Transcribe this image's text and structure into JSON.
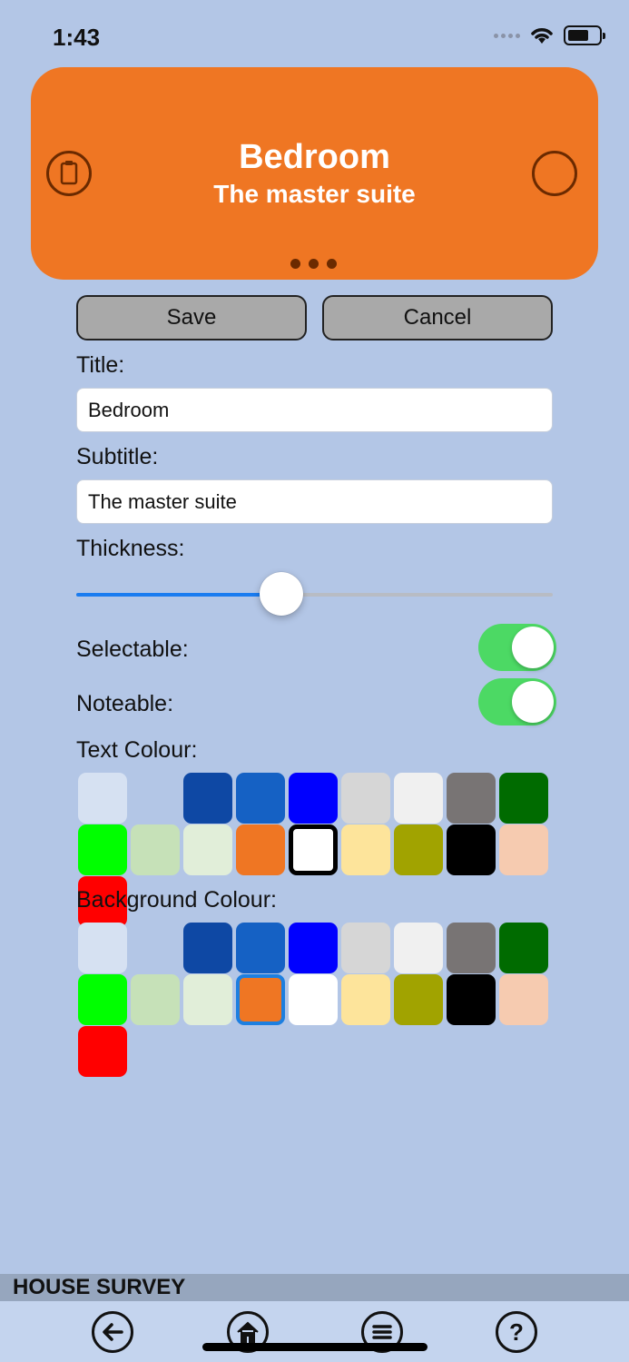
{
  "status_bar": {
    "time": "1:43"
  },
  "card": {
    "title": "Bedroom",
    "subtitle": "The master suite",
    "left_icon": "clipboard-icon",
    "right_icon": "circle-icon",
    "page_dots": 3
  },
  "actions": {
    "save_label": "Save",
    "cancel_label": "Cancel"
  },
  "form": {
    "title_label": "Title:",
    "title_value": "Bedroom",
    "subtitle_label": "Subtitle:",
    "subtitle_value": "The master suite",
    "thickness_label": "Thickness:",
    "thickness_value": 0.43,
    "selectable_label": "Selectable:",
    "selectable_on": true,
    "noteable_label": "Noteable:",
    "noteable_on": true,
    "text_colour_label": "Text Colour:",
    "background_colour_label": "Background Colour:"
  },
  "palette": [
    "#d6e1f2",
    "#b3c6e6",
    "#0e48a4",
    "#1561c4",
    "#0000ff",
    "#d6d6d6",
    "#f0f0f0",
    "#787474",
    "#006b00",
    "#00ff00",
    "#c6e1b8",
    "#e1eed9",
    "#ef7623",
    "#ffffff",
    "#fde49b",
    "#a1a300",
    "#000000",
    "#f6cbb0",
    "#ff0000"
  ],
  "text_colour_selected": 13,
  "background_colour_selected": 12,
  "footer": {
    "app_title": "HOUSE SURVEY"
  },
  "tabbar": {
    "icons": [
      "back-arrow-icon",
      "home-icon",
      "menu-icon",
      "help-icon"
    ]
  }
}
